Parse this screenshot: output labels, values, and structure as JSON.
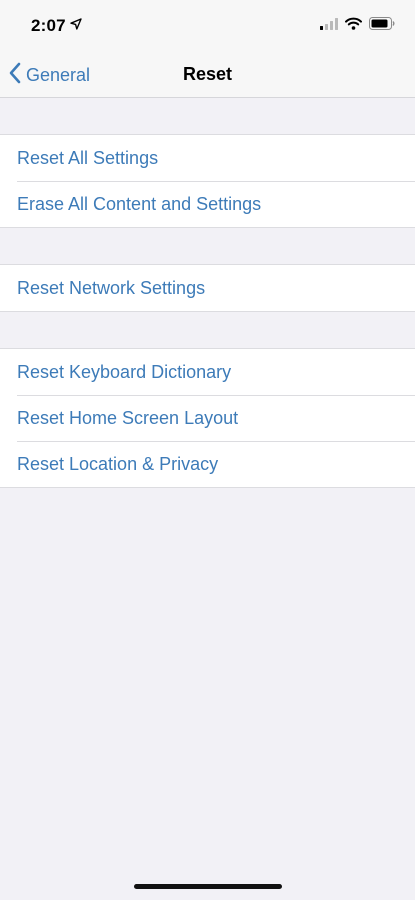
{
  "status_bar": {
    "time": "2:07",
    "icons": [
      "location-arrow-icon",
      "cellular-signal-icon",
      "wifi-icon",
      "battery-icon"
    ]
  },
  "nav_bar": {
    "back_label": "General",
    "title": "Reset",
    "back_icon": "chevron-left-icon"
  },
  "groups": [
    {
      "items": [
        {
          "label": "Reset All Settings"
        },
        {
          "label": "Erase All Content and Settings"
        }
      ]
    },
    {
      "items": [
        {
          "label": "Reset Network Settings"
        }
      ]
    },
    {
      "items": [
        {
          "label": "Reset Keyboard Dictionary"
        },
        {
          "label": "Reset Home Screen Layout"
        },
        {
          "label": "Reset Location & Privacy"
        }
      ]
    }
  ],
  "colors": {
    "accent": "#3d7bb8",
    "background": "#f2f1f6",
    "cell": "#ffffff",
    "separator": "#dcdce0"
  }
}
